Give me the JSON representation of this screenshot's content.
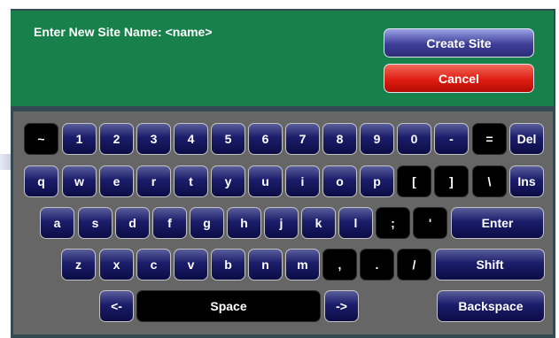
{
  "dialog": {
    "prompt": "Enter New Site Name: <name>",
    "create_label": "Create Site",
    "cancel_label": "Cancel"
  },
  "keyboard": {
    "row1": [
      "~",
      "1",
      "2",
      "3",
      "4",
      "5",
      "6",
      "7",
      "8",
      "9",
      "0",
      "-",
      "=",
      "Del"
    ],
    "row2": [
      "q",
      "w",
      "e",
      "r",
      "t",
      "y",
      "u",
      "i",
      "o",
      "p",
      "[",
      "]",
      "\\",
      "Ins"
    ],
    "row3": [
      "a",
      "s",
      "d",
      "f",
      "g",
      "h",
      "j",
      "k",
      "l",
      ";",
      "'",
      "Enter"
    ],
    "row4": [
      "z",
      "x",
      "c",
      "v",
      "b",
      "n",
      "m",
      ",",
      ".",
      "/",
      "Shift"
    ],
    "row5": [
      "<-",
      "Space",
      "->",
      "Backspace"
    ]
  },
  "colors": {
    "header_bg": "#18804a",
    "frame_bg": "#344a50",
    "keyboard_bg": "#666666",
    "key_blue": "#1b1d6a",
    "key_black": "#000000",
    "create_button": "#3d3e98",
    "cancel_button": "#df1d12"
  }
}
